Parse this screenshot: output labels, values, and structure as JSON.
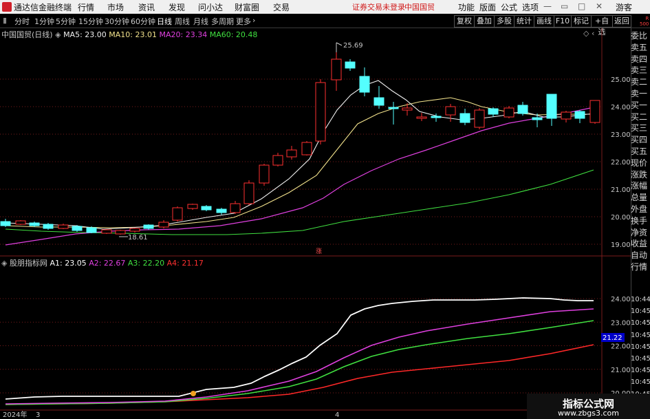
{
  "menubar": {
    "app_title": "通达信金融终端",
    "items": [
      "行情",
      "市场",
      "资讯",
      "发现",
      "问小达",
      "财富圈",
      "交易"
    ],
    "warning": "证券交易未登录",
    "stock": "中国国贸",
    "right_items": [
      "功能",
      "版面",
      "公式",
      "选项"
    ],
    "user": "游客"
  },
  "toolbar": {
    "periods": [
      "分时",
      "1分钟",
      "5分钟",
      "15分钟",
      "30分钟",
      "60分钟",
      "日线",
      "周线",
      "月线",
      "多周期",
      "更多"
    ],
    "selected": "日线",
    "buttons": [
      "复权",
      "叠加",
      "多股",
      "统计",
      "画线",
      "F10",
      "标记",
      "+自选",
      "返回"
    ]
  },
  "main_chart": {
    "title": "中国国贸(日线)",
    "legend": [
      {
        "label": "MA5: 23.00",
        "color": "#f0f0f0"
      },
      {
        "label": "MA10: 23.01",
        "color": "#f2e28c"
      },
      {
        "label": "MA20: 23.34",
        "color": "#e040e0"
      },
      {
        "label": "MA60: 20.48",
        "color": "#40e040"
      }
    ],
    "high_label": "25.69",
    "low_label": "18.61",
    "marker_label": "涨",
    "y_ticks": [
      "25.00",
      "24.00",
      "23.00",
      "22.00",
      "21.00",
      "20.00",
      "19.00"
    ],
    "up_color": "#ff3030",
    "down_color": "#54ffff"
  },
  "indicator_chart": {
    "title": "股朋指标网",
    "legend": [
      {
        "label": "A1: 23.05",
        "color": "#ffffff"
      },
      {
        "label": "A2: 22.67",
        "color": "#e040e0"
      },
      {
        "label": "A3: 22.20",
        "color": "#40e040"
      },
      {
        "label": "A4: 21.17",
        "color": "#ff3030"
      }
    ],
    "y_ticks": [
      "24.00",
      "23.00",
      "22.00",
      "21.00",
      "20.00"
    ],
    "price_badge": "21.22"
  },
  "time_axis": {
    "labels": [
      "2024年",
      "3",
      "4"
    ]
  },
  "right_panel": {
    "corner": [
      "R",
      "500"
    ],
    "labels": [
      "委比",
      "卖五",
      "卖四",
      "卖三",
      "卖二",
      "卖一",
      "买一",
      "买二",
      "买三",
      "买四",
      "买五",
      "现价",
      "涨跌",
      "涨幅",
      "总量",
      "外盘",
      "换手",
      "净资",
      "收益",
      "自动",
      "行情"
    ],
    "times": [
      "10:44",
      "10:45",
      "10:45",
      "10:45",
      "10:45",
      "10:45",
      "10:45",
      "10:45",
      "10:45"
    ]
  },
  "watermark": {
    "title": "指标公式网",
    "url": "www.zbgs3.com"
  }
}
